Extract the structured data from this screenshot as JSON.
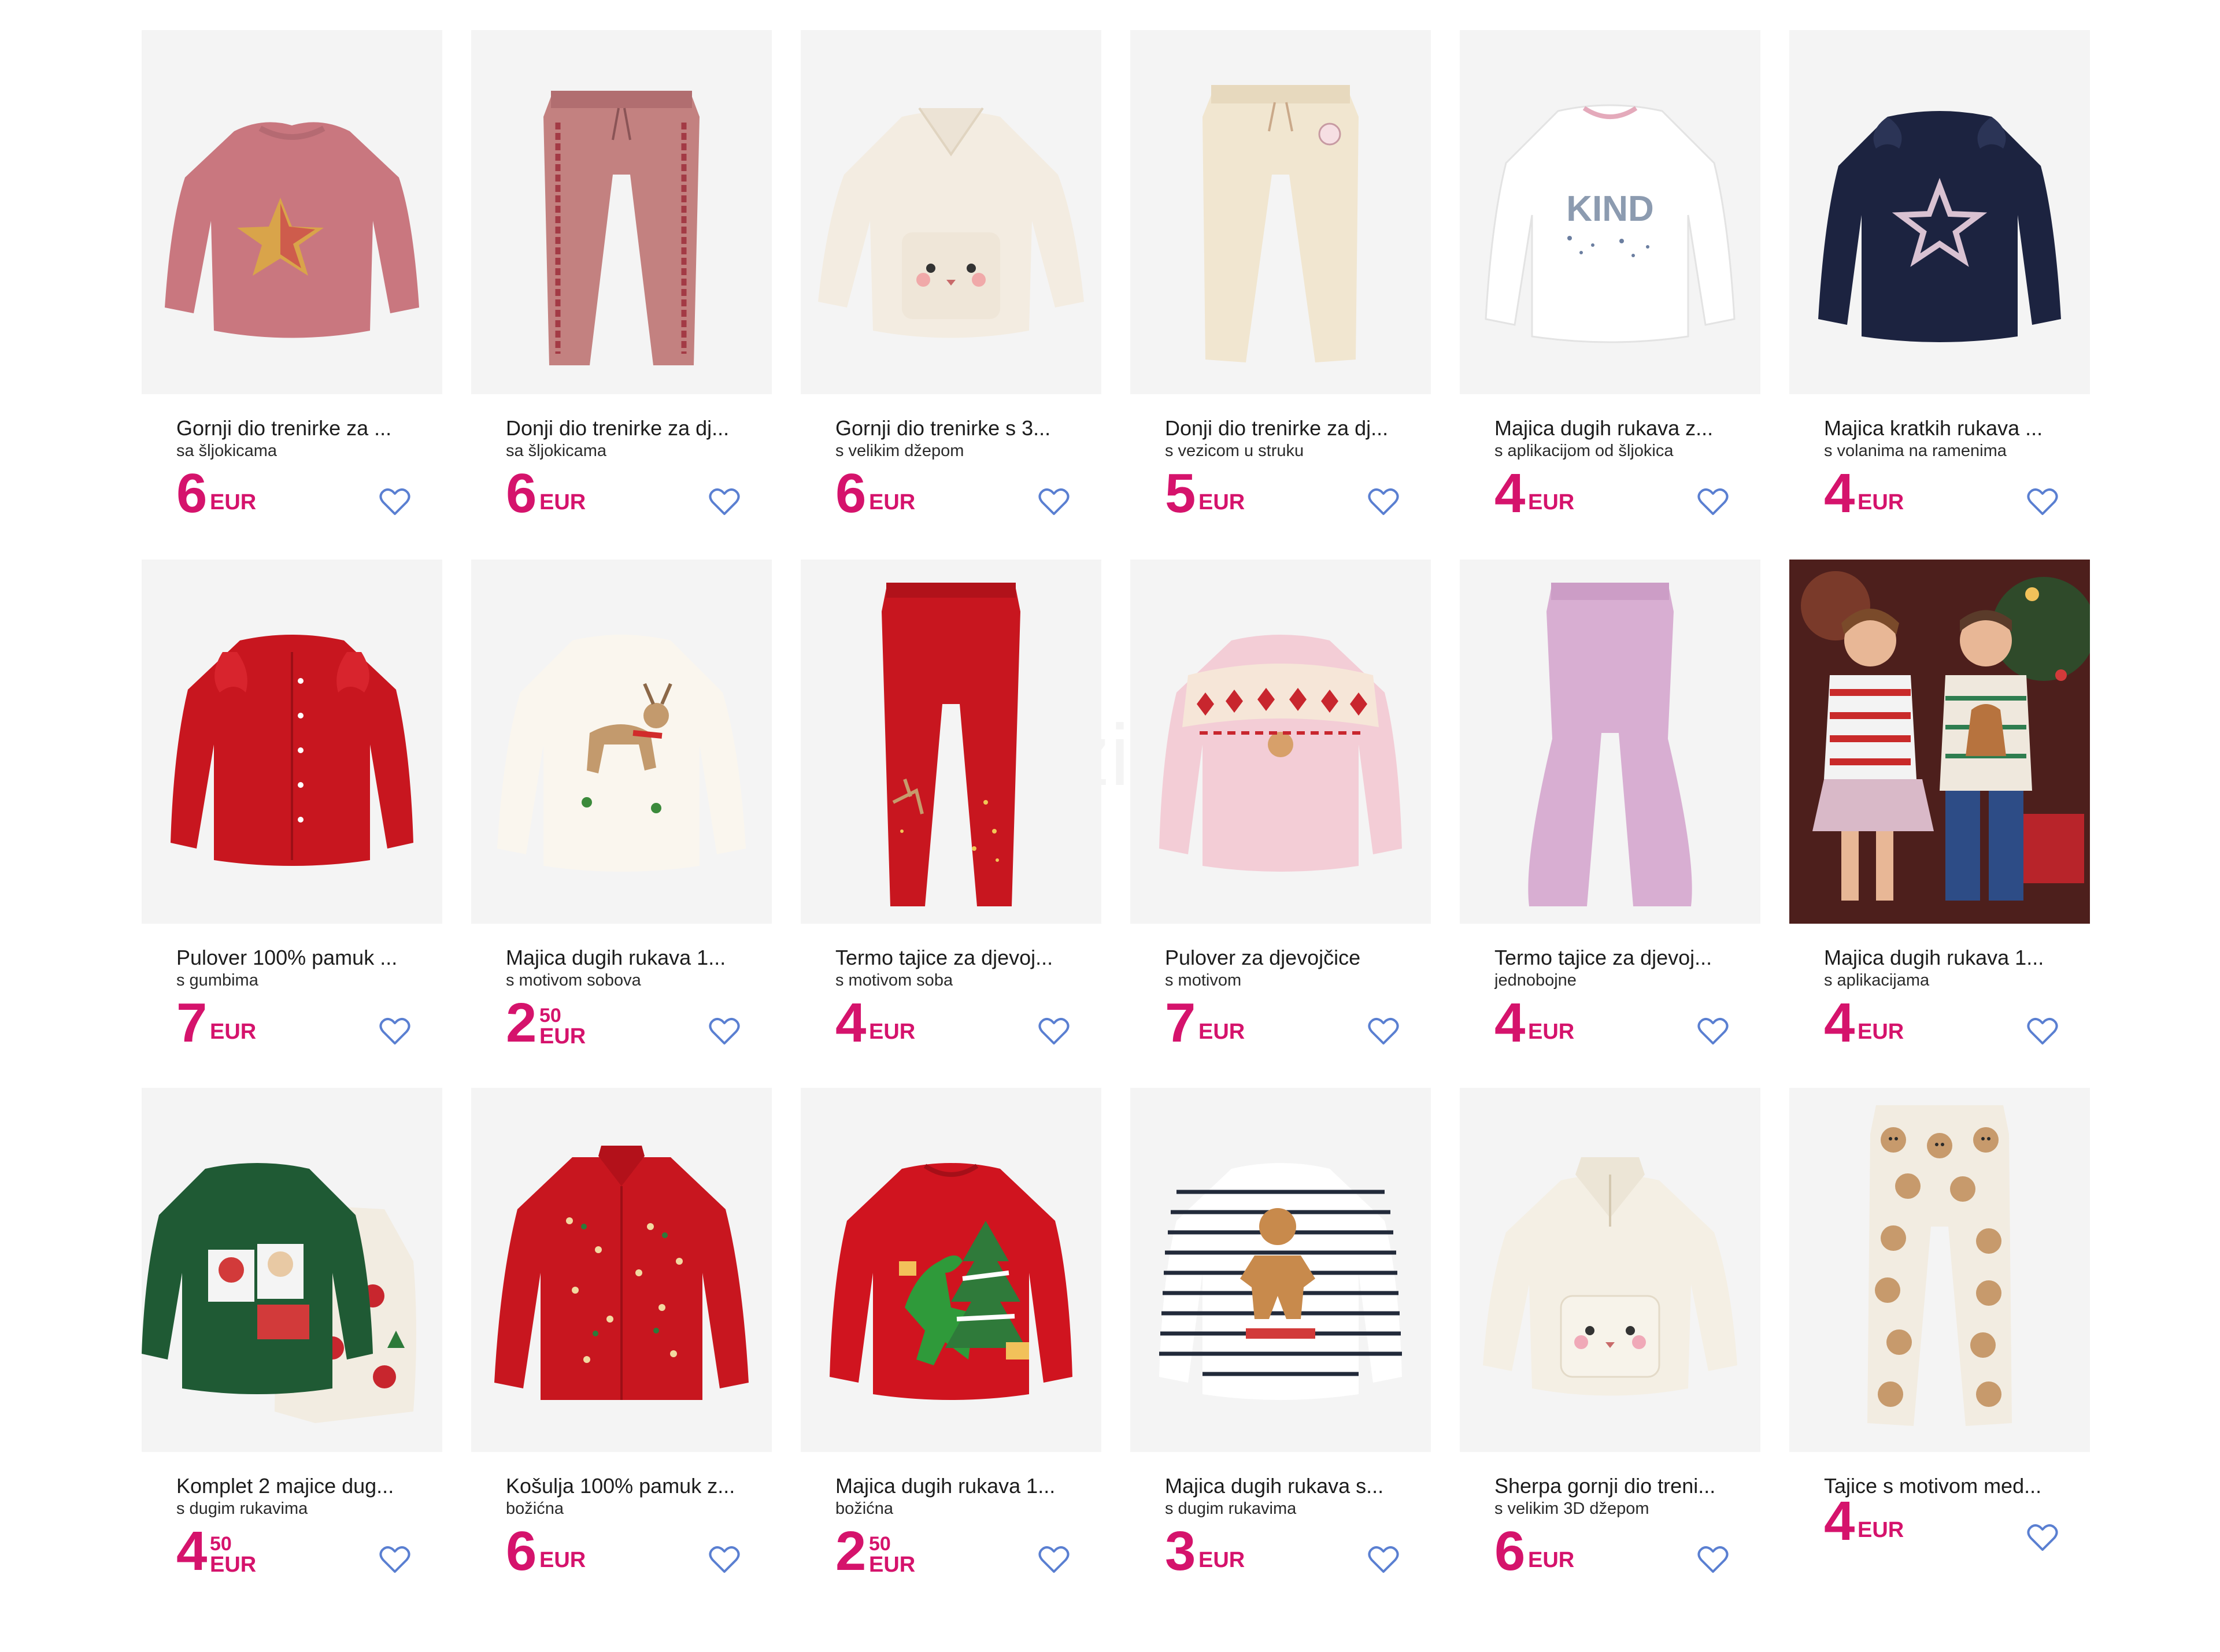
{
  "accent_color": "#d5136c",
  "heart_icon_color": "#5a7fd1",
  "watermark": "Katalozi.net",
  "products": [
    {
      "id": "p1",
      "title": "Gornji dio trenirke za ...",
      "subtitle": "sa šljokicama",
      "price_int": "6",
      "price_dec": "",
      "currency": "EUR",
      "icon": "pink-velour-sweatshirt-star-image"
    },
    {
      "id": "p2",
      "title": "Donji dio trenirke za dj...",
      "subtitle": "sa šljokicama",
      "price_int": "6",
      "price_dec": "",
      "currency": "EUR",
      "icon": "pink-velour-joggers-image"
    },
    {
      "id": "p3",
      "title": "Gornji dio trenirke s 3...",
      "subtitle": "s velikim džepom",
      "price_int": "6",
      "price_dec": "",
      "currency": "EUR",
      "icon": "cream-fleece-pullover-image"
    },
    {
      "id": "p4",
      "title": "Donji dio trenirke za dj...",
      "subtitle": "s vezicom u struku",
      "price_int": "5",
      "price_dec": "",
      "currency": "EUR",
      "icon": "cream-joggers-image"
    },
    {
      "id": "p5",
      "title": "Majica dugih rukava z...",
      "subtitle": "s aplikacijom od šljokica",
      "price_int": "4",
      "price_dec": "",
      "currency": "EUR",
      "icon": "white-longsleeve-kind-image"
    },
    {
      "id": "p6",
      "title": "Majica kratkih rukava ...",
      "subtitle": "s volanima na ramenima",
      "price_int": "4",
      "price_dec": "",
      "currency": "EUR",
      "icon": "navy-top-star-image"
    },
    {
      "id": "p7",
      "title": "Pulover 100% pamuk ...",
      "subtitle": "s gumbima",
      "price_int": "7",
      "price_dec": "",
      "currency": "EUR",
      "icon": "red-cardigan-image"
    },
    {
      "id": "p8",
      "title": "Majica dugih rukava 1...",
      "subtitle": "s motivom sobova",
      "price_int": "2",
      "price_dec": "50",
      "currency": "EUR",
      "icon": "white-longsleeve-reindeer-image"
    },
    {
      "id": "p9",
      "title": "Termo tajice za djevoj...",
      "subtitle": "s motivom soba",
      "price_int": "4",
      "price_dec": "",
      "currency": "EUR",
      "icon": "red-leggings-image"
    },
    {
      "id": "p10",
      "title": "Pulover za djevojčice",
      "subtitle": "s motivom",
      "price_int": "7",
      "price_dec": "",
      "currency": "EUR",
      "icon": "pink-nordic-sweater-image"
    },
    {
      "id": "p11",
      "title": "Termo tajice za djevoj...",
      "subtitle": "jednobojne",
      "price_int": "4",
      "price_dec": "",
      "currency": "EUR",
      "icon": "lilac-flared-leggings-image"
    },
    {
      "id": "p12",
      "title": "Majica dugih rukava 1...",
      "subtitle": "s aplikacijama",
      "price_int": "4",
      "price_dec": "",
      "currency": "EUR",
      "icon": "kids-christmas-photo-image"
    },
    {
      "id": "p13",
      "title": "Komplet 2 majice dug...",
      "subtitle": "s dugim rukavima",
      "price_int": "4",
      "price_dec": "50",
      "currency": "EUR",
      "icon": "green-christmas-tee-set-image"
    },
    {
      "id": "p14",
      "title": "Košulja 100% pamuk z...",
      "subtitle": "božićna",
      "price_int": "6",
      "price_dec": "",
      "currency": "EUR",
      "icon": "red-christmas-shirt-image"
    },
    {
      "id": "p15",
      "title": "Majica dugih rukava 1...",
      "subtitle": "božićna",
      "price_int": "2",
      "price_dec": "50",
      "currency": "EUR",
      "icon": "red-dino-longsleeve-image"
    },
    {
      "id": "p16",
      "title": "Majica dugih rukava s...",
      "subtitle": "s dugim rukavima",
      "price_int": "3",
      "price_dec": "",
      "currency": "EUR",
      "icon": "striped-gingerbread-longsleeve-image"
    },
    {
      "id": "p17",
      "title": "Sherpa gornji dio treni...",
      "subtitle": "s velikim 3D džepom",
      "price_int": "6",
      "price_dec": "",
      "currency": "EUR",
      "icon": "cream-sherpa-pullover-image"
    },
    {
      "id": "p18",
      "title": "Tajice s motivom med...",
      "subtitle": "",
      "price_int": "4",
      "price_dec": "",
      "currency": "EUR",
      "icon": "teddy-bear-leggings-image"
    }
  ]
}
